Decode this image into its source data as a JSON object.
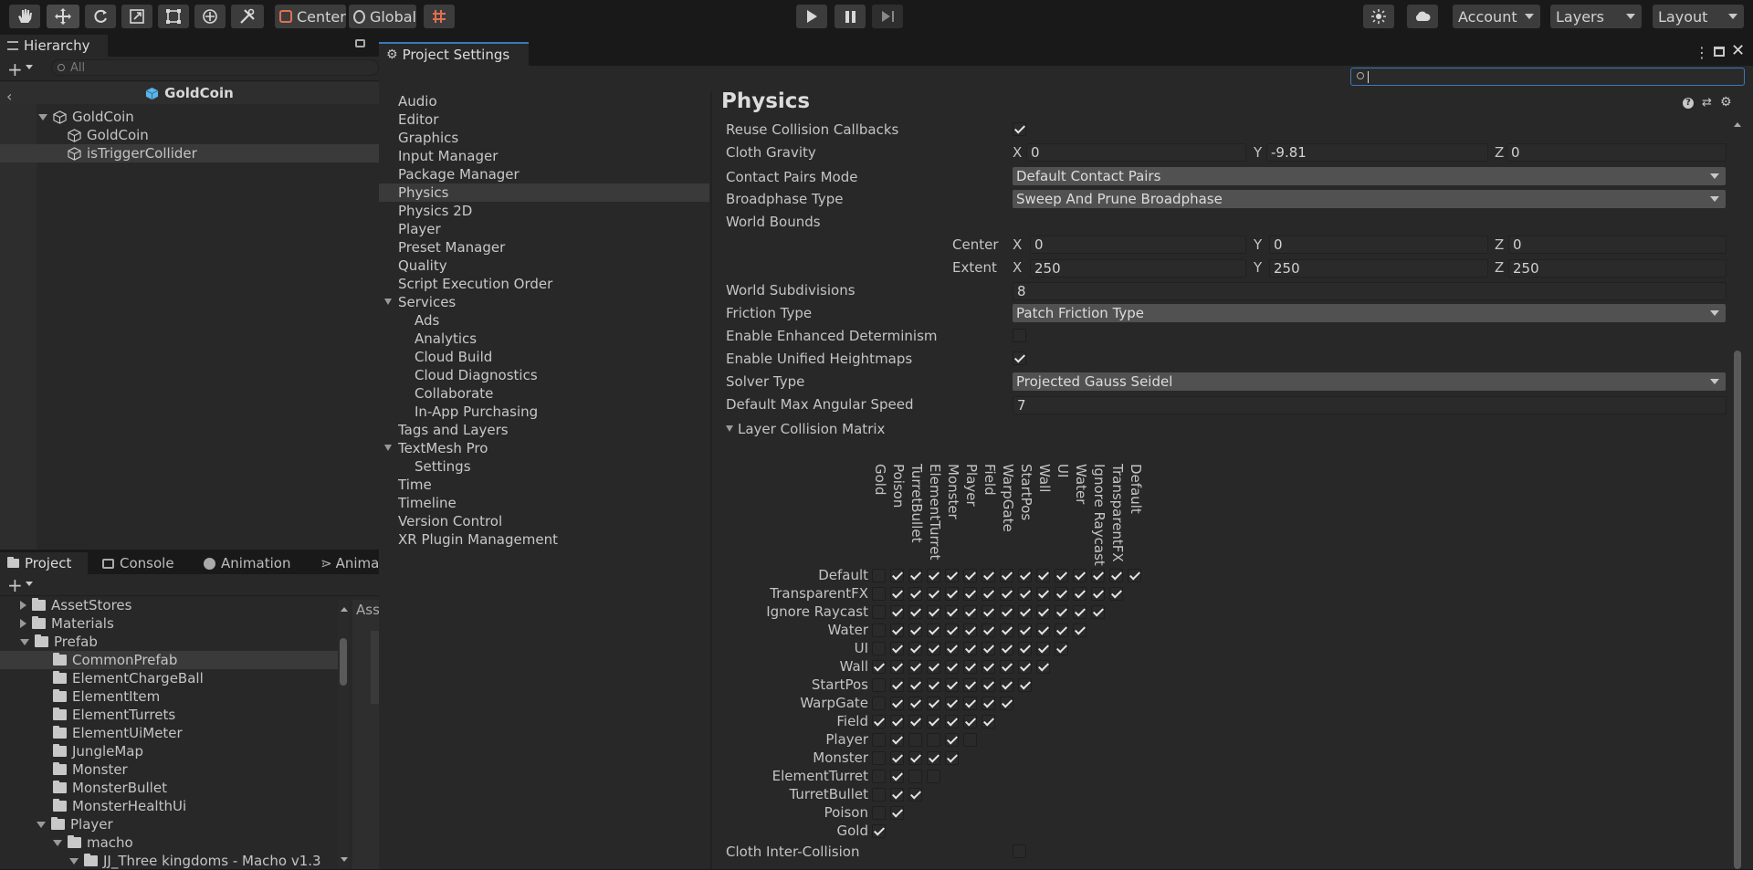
{
  "toolbar": {
    "center_label": "Center",
    "global_label": "Global",
    "account_label": "Account",
    "layers_label": "Layers",
    "layout_label": "Layout"
  },
  "hierarchy": {
    "tab_label": "Hierarchy",
    "search_placeholder": "All",
    "scene_title": "GoldCoin",
    "items": [
      "GoldCoin",
      "GoldCoin",
      "isTriggerCollider"
    ]
  },
  "bottom_tabs": {
    "project": "Project",
    "console": "Console",
    "animation": "Animation",
    "animator": "Animat"
  },
  "project": {
    "asset_header": "Ass",
    "tree": [
      "AssetStores",
      "Materials",
      "Prefab",
      "CommonPrefab",
      "ElementChargeBall",
      "ElementItem",
      "ElementTurrets",
      "ElementUiMeter",
      "JungleMap",
      "Monster",
      "MonsterBullet",
      "MonsterHealthUi",
      "Player",
      "macho",
      "JJ_Three kingdoms - Macho v1.3"
    ]
  },
  "settings": {
    "window_title": "Project Settings",
    "nav": [
      "Audio",
      "Editor",
      "Graphics",
      "Input Manager",
      "Package Manager",
      "Physics",
      "Physics 2D",
      "Player",
      "Preset Manager",
      "Quality",
      "Script Execution Order",
      "Services",
      "Ads",
      "Analytics",
      "Cloud Build",
      "Cloud Diagnostics",
      "Collaborate",
      "In-App Purchasing",
      "Tags and Layers",
      "TextMesh Pro",
      "Settings",
      "Time",
      "Timeline",
      "Version Control",
      "XR Plugin Management"
    ],
    "page_title": "Physics",
    "props": {
      "reuse_callbacks": "Reuse Collision Callbacks",
      "cloth_gravity": "Cloth Gravity",
      "contact_pairs": "Contact Pairs Mode",
      "broadphase": "Broadphase Type",
      "world_bounds": "World Bounds",
      "center": "Center",
      "extent": "Extent",
      "world_subdiv": "World Subdivisions",
      "friction": "Friction Type",
      "determinism": "Enable Enhanced Determinism",
      "heightmaps": "Enable Unified Heightmaps",
      "solver": "Solver Type",
      "angular": "Default Max Angular Speed",
      "matrix": "Layer Collision Matrix",
      "cloth_inter": "Cloth Inter-Collision"
    },
    "axes": {
      "x": "X",
      "y": "Y",
      "z": "Z"
    },
    "values": {
      "gravity_x": "0",
      "gravity_y": "-9.81",
      "gravity_z": "0",
      "contact_pairs": "Default Contact Pairs",
      "broadphase": "Sweep And Prune Broadphase",
      "center_x": "0",
      "center_y": "0",
      "center_z": "0",
      "extent_x": "250",
      "extent_y": "250",
      "extent_z": "250",
      "world_subdiv": "8",
      "friction": "Patch Friction Type",
      "solver": "Projected Gauss Seidel",
      "angular": "7"
    }
  },
  "matrix": {
    "columns": [
      "Gold",
      "Poison",
      "TurretBullet",
      "ElementTurret",
      "Monster",
      "Player",
      "Field",
      "WarpGate",
      "StartPos",
      "Wall",
      "UI",
      "Water",
      "Ignore Raycast",
      "TransparentFX",
      "Default"
    ],
    "rows": [
      "Default",
      "TransparentFX",
      "Ignore Raycast",
      "Water",
      "UI",
      "Wall",
      "StartPos",
      "WarpGate",
      "Field",
      "Player",
      "Monster",
      "ElementTurret",
      "TurretBullet",
      "Poison",
      "Gold"
    ],
    "cells": [
      [
        0,
        1,
        1,
        1,
        1,
        1,
        1,
        1,
        1,
        1,
        1,
        1,
        1,
        1,
        1
      ],
      [
        0,
        1,
        1,
        1,
        1,
        1,
        1,
        1,
        1,
        1,
        1,
        1,
        1,
        1
      ],
      [
        0,
        1,
        1,
        1,
        1,
        1,
        1,
        1,
        1,
        1,
        1,
        1,
        1
      ],
      [
        0,
        1,
        1,
        1,
        1,
        1,
        1,
        1,
        1,
        1,
        1,
        1
      ],
      [
        0,
        1,
        1,
        1,
        1,
        1,
        1,
        1,
        1,
        1,
        1
      ],
      [
        1,
        1,
        1,
        1,
        1,
        1,
        1,
        1,
        1,
        1
      ],
      [
        0,
        1,
        1,
        1,
        1,
        1,
        1,
        1,
        1
      ],
      [
        0,
        1,
        1,
        1,
        1,
        1,
        1,
        1
      ],
      [
        1,
        1,
        1,
        1,
        1,
        1,
        1
      ],
      [
        0,
        1,
        0,
        0,
        1,
        0
      ],
      [
        0,
        1,
        1,
        1,
        1
      ],
      [
        0,
        1,
        0,
        0
      ],
      [
        0,
        1,
        1
      ],
      [
        0,
        1
      ],
      [
        1
      ]
    ]
  }
}
